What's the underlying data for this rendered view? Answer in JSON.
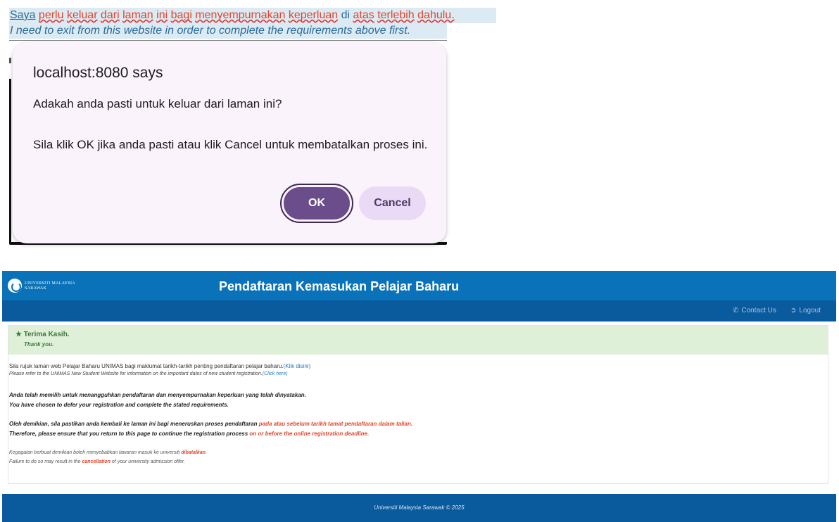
{
  "snippet": {
    "ms_words": [
      "Saya",
      "perlu",
      "keluar",
      "dari",
      "laman",
      "ini",
      "bagi",
      "menyempurnakan",
      "keperluan",
      "di",
      "atas",
      "terlebih",
      "dahulu."
    ],
    "en_line": "I need to exit from this website in order to complete the requirements above first."
  },
  "dialog": {
    "title": "localhost:8080 says",
    "line1": "Adakah anda pasti untuk keluar dari laman ini?",
    "line2": "Sila klik OK jika anda pasti atau klik Cancel untuk membatalkan proses ini.",
    "ok_label": "OK",
    "cancel_label": "Cancel"
  },
  "web": {
    "logo_line1": "UNIVERSITI MALAYSIA",
    "logo_line2": "SARAWAK",
    "banner_title": "Pendaftaran Kemasukan Pelajar Baharu",
    "nav": {
      "contact_icon": "phone-icon",
      "contact": "Contact Us",
      "logout_icon": "logout-icon",
      "logout": "Logout"
    },
    "thanks_ms": "Terima Kasih.",
    "thanks_en": "Thank you.",
    "p1_ms": "Sila rujuk laman web Pelajar Baharu UNIMAS bagi maklumat tarikh-tarikh penting pendaftaran pelajar baharu.",
    "p1_ms_link": "(Klik disini)",
    "p1_en": "Please refer to the UNIMAS New Student Website for information on the important dates of new student registration.",
    "p1_en_link": "(Click here)",
    "p2_ms": "Anda telah memilih untuk menangguhkan pendaftaran dan menyempurnakan keperluan yang telah dinyatakan.",
    "p2_en": "You have chosen to defer your registration and complete the stated requirements.",
    "p3_ms": "Oleh demikian, sila pastikan anda kembali ke laman ini bagi meneruskan proses pendaftaran ",
    "p3_ms_red": "pada atau sebelum tarikh tamat pendaftaran dalam talian.",
    "p3_en": "Therefore, please ensure that you return to this page to continue the registration process ",
    "p3_en_red": "on or before the online registration deadline.",
    "p4_ms": "Kegagalan berbuat demikian boleh menyebabkan tawaran masuk ke universiti ",
    "p4_ms_red": "dibatalkan",
    "p4_ms_end": ".",
    "p4_en": "Failure to do so may result in the ",
    "p4_en_red": "cancellation",
    "p4_en_end": " of your university admission offer.",
    "footer": "Universiti Malaysia Sarawak © 2025"
  }
}
